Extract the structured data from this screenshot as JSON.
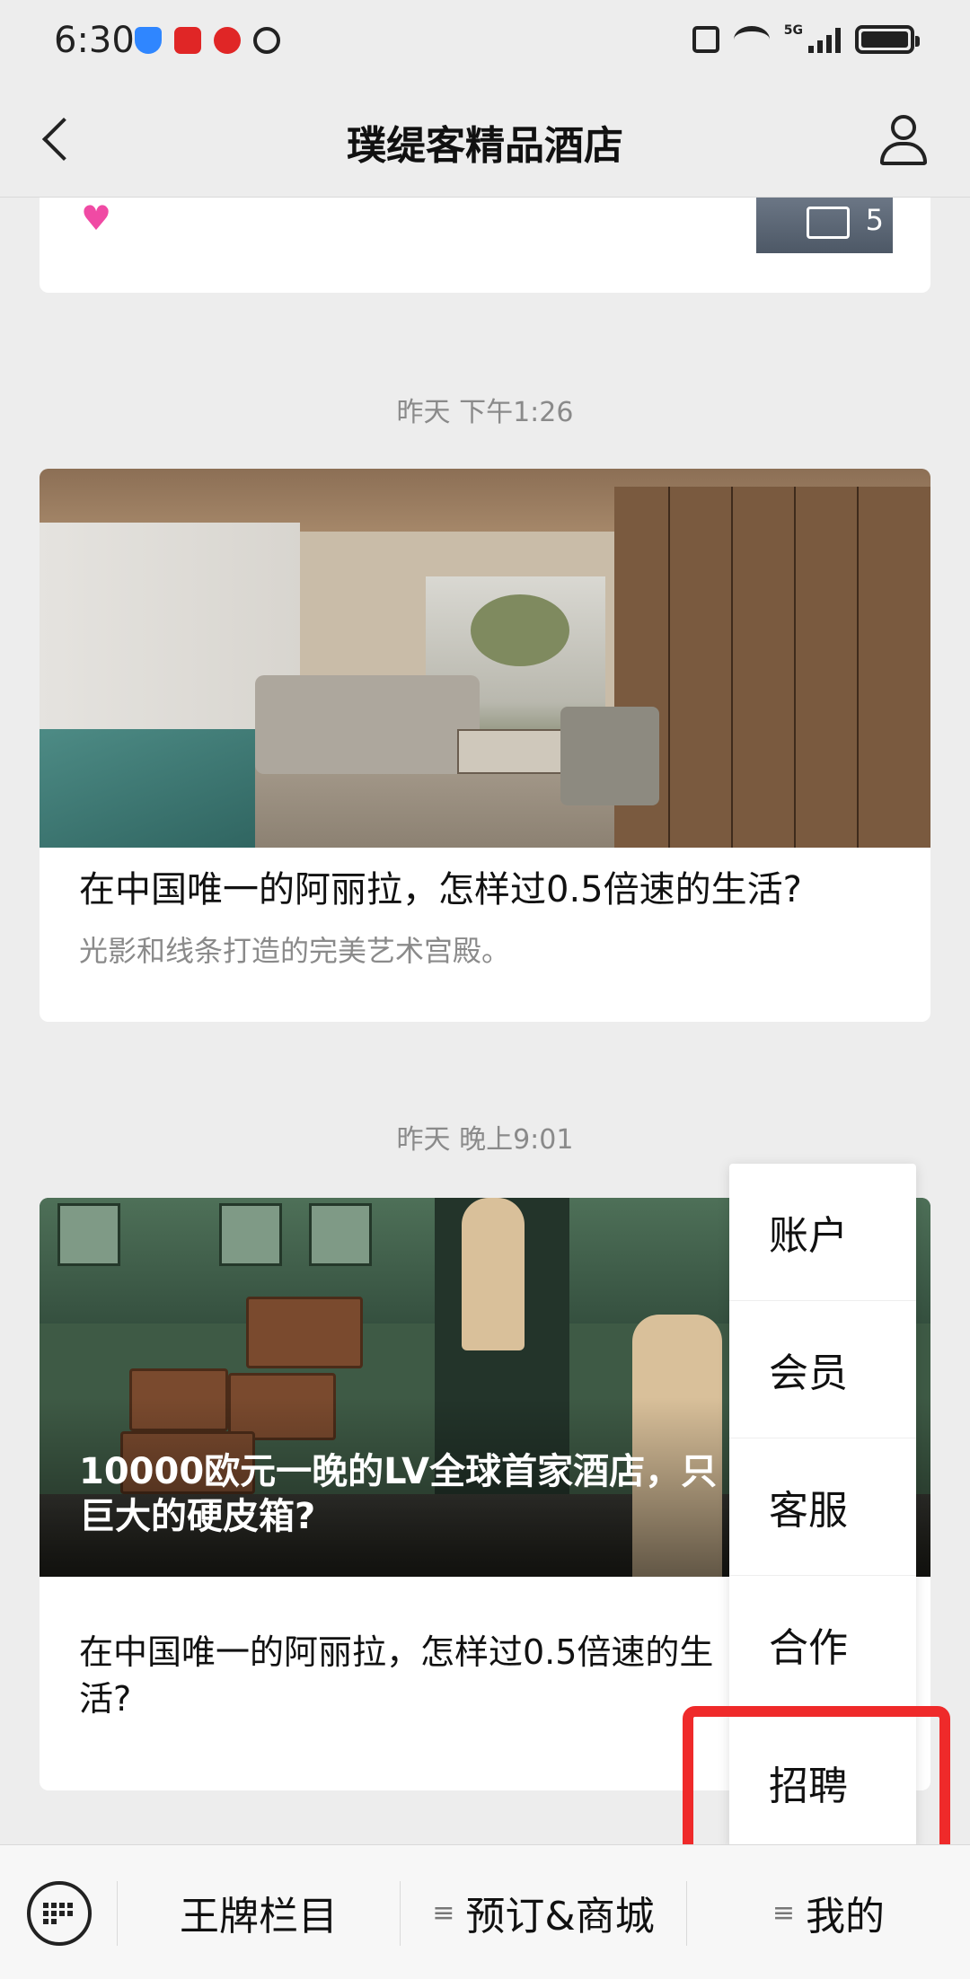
{
  "status_bar": {
    "time": "6:30",
    "network": "5G",
    "icons_left": [
      "shield-icon",
      "video-icon",
      "metro-icon",
      "alarm-icon"
    ],
    "icons_right": [
      "vibrate-icon",
      "wifi-icon",
      "signal-icon",
      "battery-icon"
    ]
  },
  "header": {
    "title": "璞缇客精品酒店"
  },
  "top_card": {
    "image_count": "5"
  },
  "feed": [
    {
      "timestamp": "昨天 下午1:26",
      "title": "在中国唯一的阿丽拉，怎样过0.5倍速的生活?",
      "desc": "光影和线条打造的完美艺术宫殿。"
    },
    {
      "timestamp": "昨天 晚上9:01",
      "overlay_title": "10000欧元一晚的LV全球首家酒店，只巨大的硬皮箱?",
      "title": "在中国唯一的阿丽拉，怎样过0.5倍速的生活?"
    }
  ],
  "popup_menu": {
    "items": [
      "账户",
      "会员",
      "客服",
      "合作",
      "招聘"
    ],
    "highlighted": "招聘",
    "highlight_color": "#ef2a2a"
  },
  "bottom_bar": {
    "tabs": [
      "王牌栏目",
      "预订&商城",
      "我的"
    ]
  }
}
